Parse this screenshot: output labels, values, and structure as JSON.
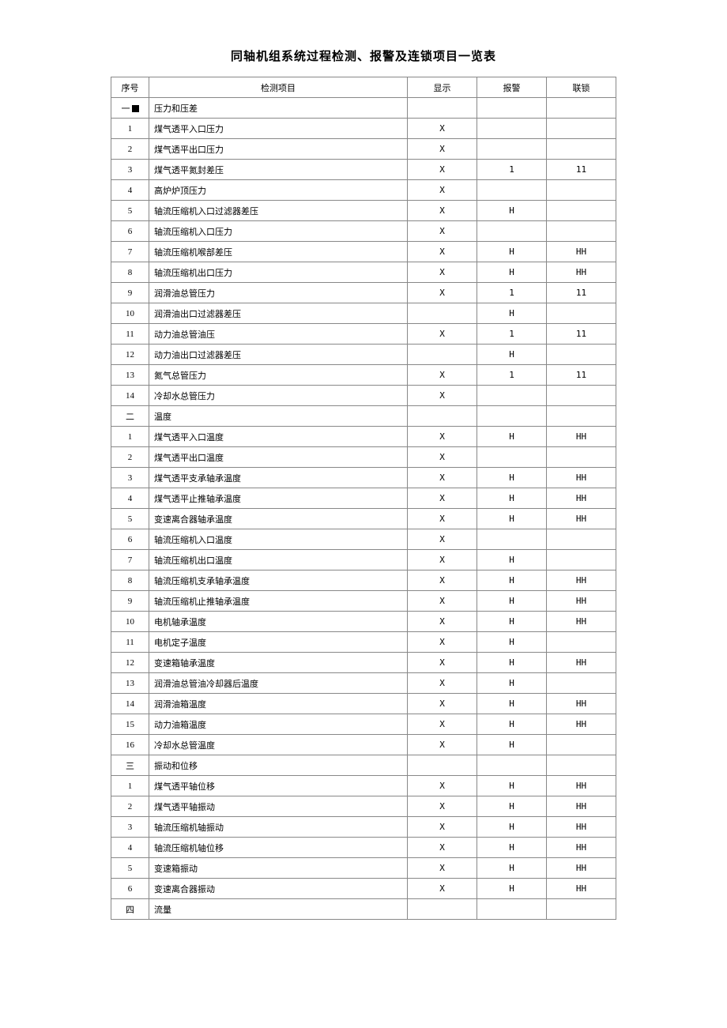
{
  "title": "同轴机组系统过程检测、报警及连锁项目一览表",
  "headers": {
    "sn": "序号",
    "item": "检测项目",
    "disp": "显示",
    "alarm": "报警",
    "lock": "联锁"
  },
  "rows": [
    {
      "sn": "一■",
      "item": "压力和压差",
      "disp": "",
      "alarm": "",
      "lock": ""
    },
    {
      "sn": "1",
      "item": "煤气透平入口压力",
      "disp": "X",
      "alarm": "",
      "lock": ""
    },
    {
      "sn": "2",
      "item": "煤气透平出口压力",
      "disp": "X",
      "alarm": "",
      "lock": ""
    },
    {
      "sn": "3",
      "item": "煤气透平氮封差压",
      "disp": "X",
      "alarm": "1",
      "lock": "11"
    },
    {
      "sn": "4",
      "item": "高炉炉顶压力",
      "disp": "X",
      "alarm": "",
      "lock": ""
    },
    {
      "sn": "5",
      "item": "轴流压缩机入口过滤器差压",
      "disp": "X",
      "alarm": "H",
      "lock": ""
    },
    {
      "sn": "6",
      "item": "轴流压缩机入口压力",
      "disp": "X",
      "alarm": "",
      "lock": ""
    },
    {
      "sn": "7",
      "item": "轴流压缩机喉部差压",
      "disp": "X",
      "alarm": "H",
      "lock": "HH"
    },
    {
      "sn": "8",
      "item": "轴流压缩机出口压力",
      "disp": "X",
      "alarm": "H",
      "lock": "HH"
    },
    {
      "sn": "9",
      "item": "润滑油总管压力",
      "disp": "X",
      "alarm": "1",
      "lock": "11"
    },
    {
      "sn": "10",
      "item": "润滑油出口过滤器差压",
      "disp": "",
      "alarm": "H",
      "lock": ""
    },
    {
      "sn": "11",
      "item": "动力油总管油压",
      "disp": "X",
      "alarm": "1",
      "lock": "11"
    },
    {
      "sn": "12",
      "item": "动力油出口过滤器差压",
      "disp": "",
      "alarm": "H",
      "lock": ""
    },
    {
      "sn": "13",
      "item": "氮气总管压力",
      "disp": "X",
      "alarm": "1",
      "lock": "11"
    },
    {
      "sn": "14",
      "item": "冷却水总管压力",
      "disp": "X",
      "alarm": "",
      "lock": ""
    },
    {
      "sn": "二",
      "item": "温度",
      "disp": "",
      "alarm": "",
      "lock": ""
    },
    {
      "sn": "1",
      "item": "煤气透平入口温度",
      "disp": "X",
      "alarm": "H",
      "lock": "HH"
    },
    {
      "sn": "2",
      "item": "煤气透平出口温度",
      "disp": "X",
      "alarm": "",
      "lock": ""
    },
    {
      "sn": "3",
      "item": "煤气透平支承轴承温度",
      "disp": "X",
      "alarm": "H",
      "lock": "HH"
    },
    {
      "sn": "4",
      "item": "煤气透平止推轴承温度",
      "disp": "X",
      "alarm": "H",
      "lock": "HH"
    },
    {
      "sn": "5",
      "item": "变速离合器轴承温度",
      "disp": "X",
      "alarm": "H",
      "lock": "HH"
    },
    {
      "sn": "6",
      "item": "轴流压缩机入口温度",
      "disp": "X",
      "alarm": "",
      "lock": ""
    },
    {
      "sn": "7",
      "item": "轴流压缩机出口温度",
      "disp": "X",
      "alarm": "H",
      "lock": ""
    },
    {
      "sn": "8",
      "item": "轴流压缩机支承轴承温度",
      "disp": "X",
      "alarm": "H",
      "lock": "HH"
    },
    {
      "sn": "9",
      "item": "轴流压缩机止推轴承温度",
      "disp": "X",
      "alarm": "H",
      "lock": "HH"
    },
    {
      "sn": "10",
      "item": "电机轴承温度",
      "disp": "X",
      "alarm": "H",
      "lock": "HH"
    },
    {
      "sn": "11",
      "item": "电机定子温度",
      "disp": "X",
      "alarm": "H",
      "lock": ""
    },
    {
      "sn": "12",
      "item": "变速箱轴承温度",
      "disp": "X",
      "alarm": "H",
      "lock": "HH"
    },
    {
      "sn": "13",
      "item": "润滑油总管油冷却器后温度",
      "disp": "X",
      "alarm": "H",
      "lock": ""
    },
    {
      "sn": "14",
      "item": "润滑油箱温度",
      "disp": "X",
      "alarm": "H",
      "lock": "HH"
    },
    {
      "sn": "15",
      "item": "动力油箱温度",
      "disp": "X",
      "alarm": "H",
      "lock": "HH"
    },
    {
      "sn": "16",
      "item": "冷却水总管温度",
      "disp": "X",
      "alarm": "H",
      "lock": ""
    },
    {
      "sn": "三",
      "item": "振动和位移",
      "disp": "",
      "alarm": "",
      "lock": ""
    },
    {
      "sn": "1",
      "item": "煤气透平轴位移",
      "disp": "X",
      "alarm": "H",
      "lock": "HH"
    },
    {
      "sn": "2",
      "item": "煤气透平轴振动",
      "disp": "X",
      "alarm": "H",
      "lock": "HH"
    },
    {
      "sn": "3",
      "item": "轴流压缩机轴振动",
      "disp": "X",
      "alarm": "H",
      "lock": "HH"
    },
    {
      "sn": "4",
      "item": "轴流压缩机轴位移",
      "disp": "X",
      "alarm": "H",
      "lock": "HH"
    },
    {
      "sn": "5",
      "item": "变速箱振动",
      "disp": "X",
      "alarm": "H",
      "lock": "HH"
    },
    {
      "sn": "6",
      "item": "变速离合器振动",
      "disp": "X",
      "alarm": "H",
      "lock": "HH"
    },
    {
      "sn": "四",
      "item": "流量",
      "disp": "",
      "alarm": "",
      "lock": ""
    }
  ]
}
